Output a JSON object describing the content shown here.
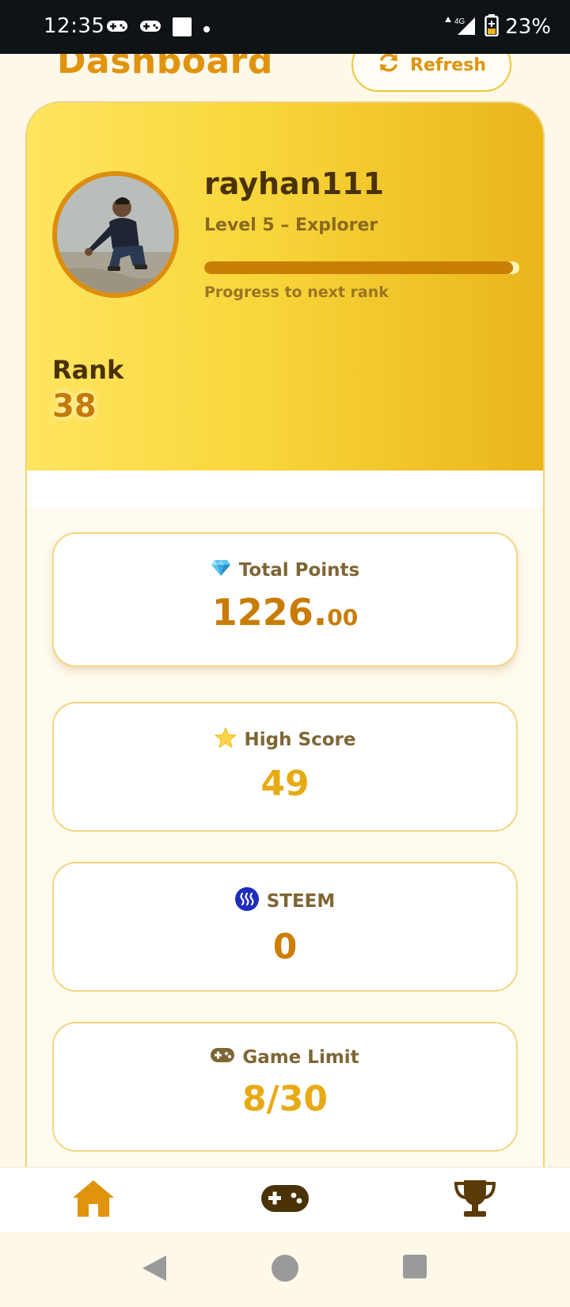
{
  "status_bar": {
    "time": "12:35",
    "network": "4G",
    "battery": "23%",
    "notification_icons": [
      "game-controller-icon",
      "game-controller-icon",
      "square-icon",
      "dot-icon"
    ]
  },
  "header": {
    "title": "Dashboard",
    "refresh_label": "Refresh"
  },
  "profile": {
    "username": "rayhan111",
    "level": "Level 5 – Explorer",
    "progress_label": "Progress to next rank",
    "progress_fraction": 0.98,
    "rank_label": "Rank",
    "rank_value": "38"
  },
  "stats": {
    "total_points": {
      "icon": "gem-icon",
      "label": "Total Points",
      "integer": "1226.",
      "decimals": "00"
    },
    "high_score": {
      "icon": "star-icon",
      "label": "High Score",
      "value": "49"
    },
    "steem": {
      "icon": "steem-logo-icon",
      "label": "STEEM",
      "value": "0"
    },
    "game_limit": {
      "icon": "gamepad-icon",
      "label": "Game Limit",
      "value": "8/30"
    }
  },
  "bottom_nav": {
    "items": [
      {
        "icon": "home-icon",
        "active": true
      },
      {
        "icon": "game-controller-icon",
        "active": false
      },
      {
        "icon": "trophy-icon",
        "active": false
      }
    ]
  },
  "colors": {
    "accent": "#e0930c",
    "gold_light": "#ffe560",
    "gold_dark": "#eab51a",
    "brown_text": "#4a3207",
    "steem_blue": "#1d2dbf"
  }
}
